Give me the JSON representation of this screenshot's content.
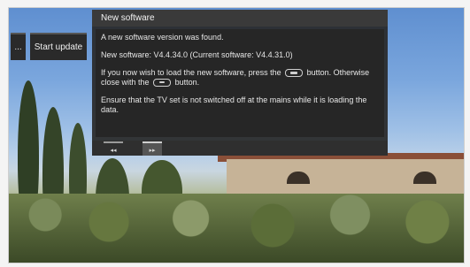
{
  "sidebar_buttons": {
    "more": "...",
    "start": "Start update"
  },
  "dialog": {
    "title": "New software",
    "line1": "A new software version was found.",
    "version_line": "New software:  V4.4.34.0   (Current software:  V4.4.31.0)",
    "instruction_a": "If you now wish to load the new software, press the",
    "instruction_b": "button. Otherwise close with the",
    "instruction_c": "button.",
    "warning": "Ensure that the TV set is not switched off at the mains while it is loading the data."
  },
  "nav": {
    "prev": "◂◂",
    "next": "▸▸"
  },
  "icons": {
    "ok_button": "remote-ok-icon",
    "exit_button": "remote-exit-icon"
  }
}
